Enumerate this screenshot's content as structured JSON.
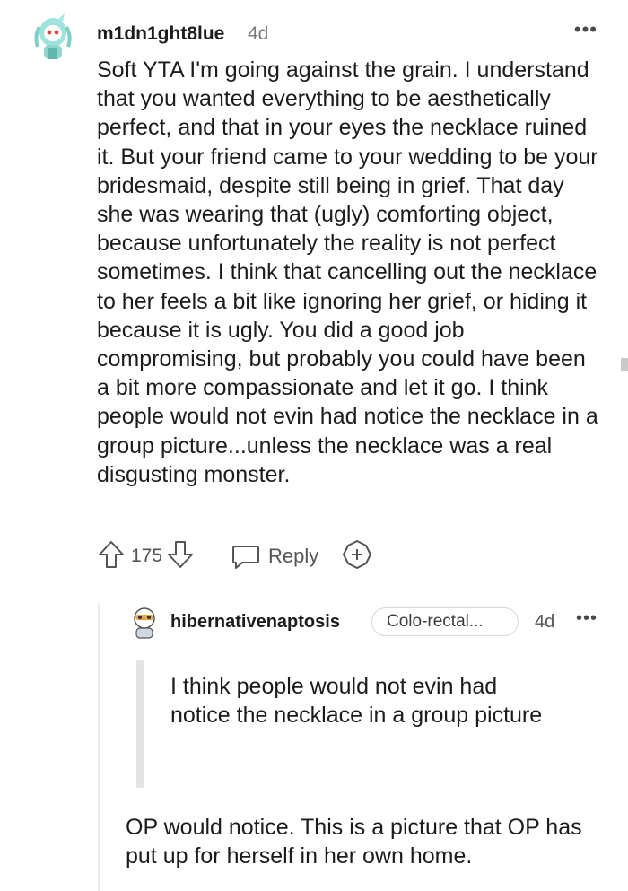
{
  "comment": {
    "username": "m1dn1ght8lue",
    "age": "4d",
    "more_label": "•••",
    "body": "Soft YTA I'm going against the grain. I understand that you wanted everything to be aesthetically perfect, and that in your eyes the necklace ruined it. But your friend came to your wedding to be your bridesmaid, despite still being in grief. That day she was wearing that (ugly) comforting object, because unfortunately the reality is not perfect sometimes. I think that cancelling out the necklace to her feels a bit like ignoring her grief, or hiding it because it is ugly. You did a good job compromising, but probably you could have been a bit more compassionate and let it go. I think people would not evin had notice the necklace in a group picture...unless the necklace was a real disgusting monster.",
    "votes": "175",
    "reply_label": "Reply",
    "icons": [
      "upvote-icon",
      "downvote-icon",
      "reply-icon",
      "award-icon"
    ]
  },
  "reply": {
    "username": "hibernativenaptosis",
    "flair": "Colo-rectal...",
    "age": "4d",
    "more_label": "•••",
    "quote": "I think people would not evin had notice the necklace in a group picture",
    "body": "OP would notice. This is a picture that OP has put up for herself in her own home."
  }
}
